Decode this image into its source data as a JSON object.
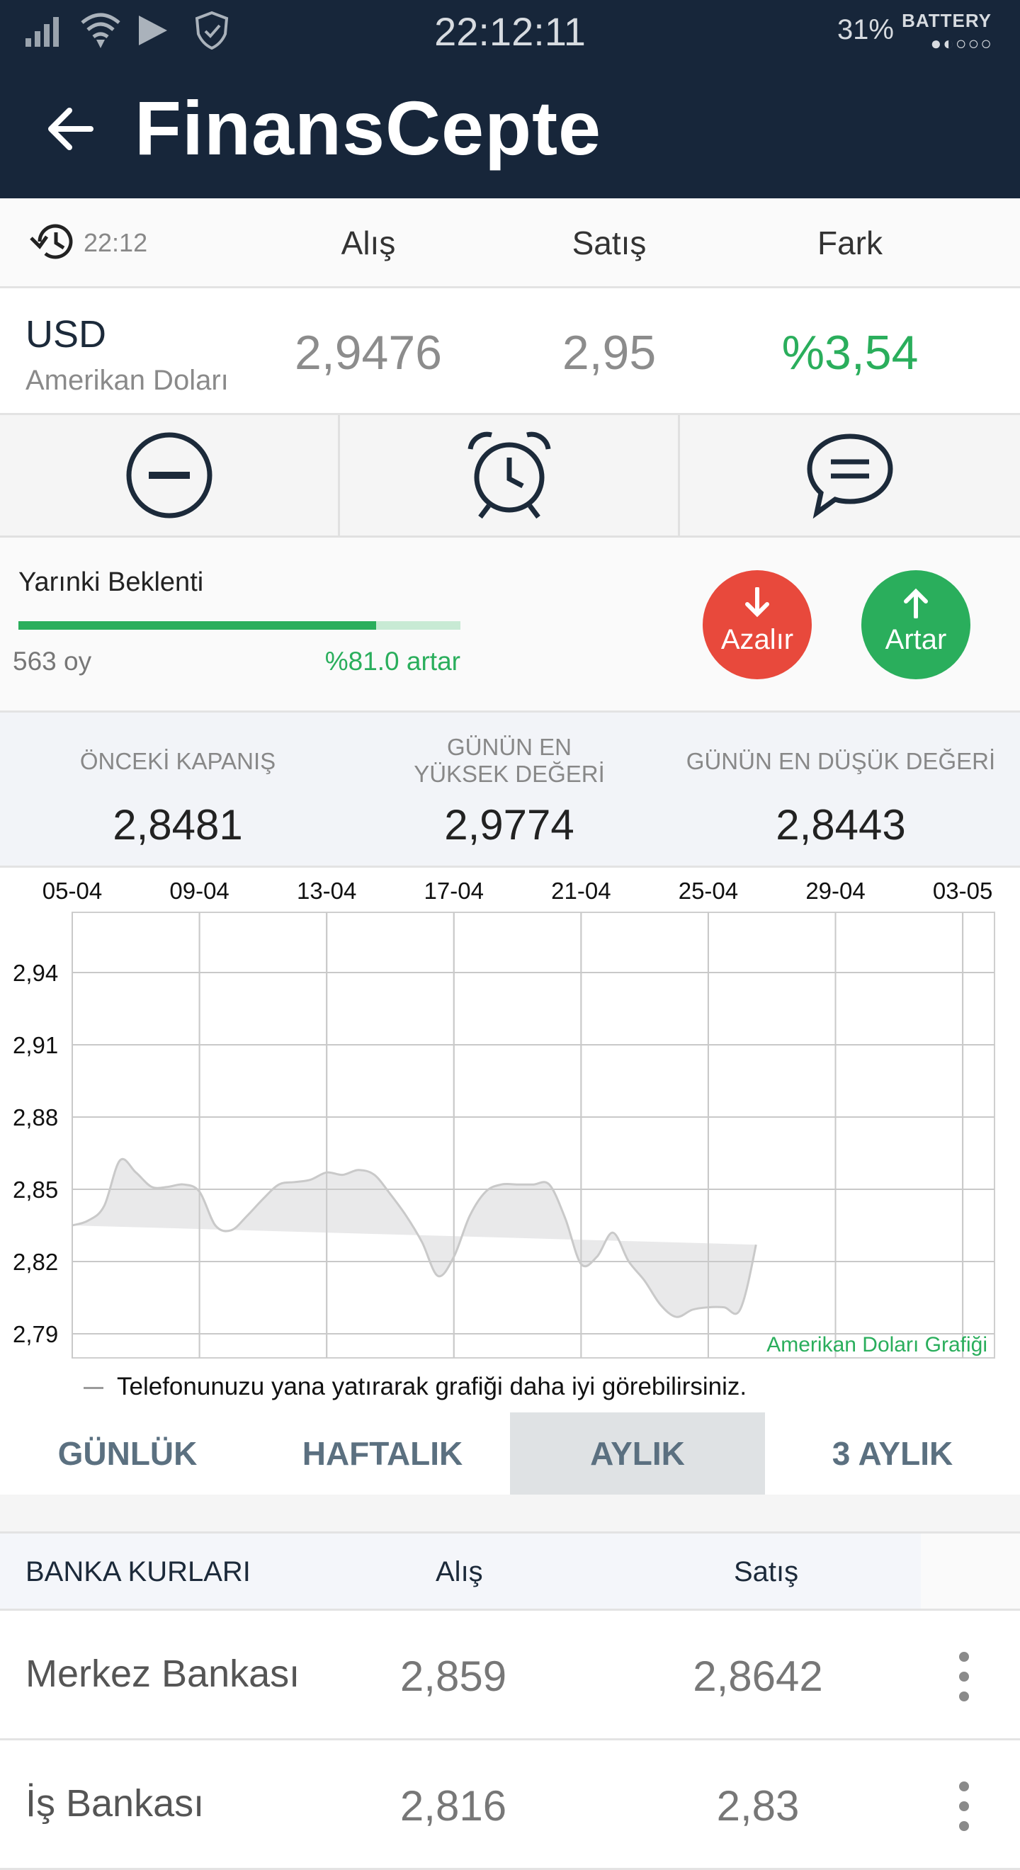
{
  "status_bar": {
    "time": "22:12:11",
    "battery_percent": "31%",
    "battery_label": "BATTERY",
    "icons": [
      "signal-icon",
      "wifi-icon",
      "play-icon",
      "shield-icon"
    ]
  },
  "app_bar": {
    "title": "FinansCepte",
    "back_icon": "back-arrow-icon"
  },
  "rate_header": {
    "time": "22:12",
    "col_buy": "Alış",
    "col_sell": "Satış",
    "col_diff": "Fark"
  },
  "currency": {
    "code": "USD",
    "name": "Amerikan Doları",
    "buy": "2,9476",
    "sell": "2,95",
    "diff": "%3,54",
    "diff_color": "#2aae5c"
  },
  "actions": [
    "remove-icon",
    "alarm-icon",
    "comment-icon"
  ],
  "expectation": {
    "label": "Yarınki Beklenti",
    "votes": "563 oy",
    "percent_text": "%81.0 artar",
    "increase_fraction": 0.81,
    "decrease_label": "Azalır",
    "increase_label": "Artar",
    "decrease_color": "#e8493c",
    "increase_color": "#2aae5c"
  },
  "stats": [
    {
      "label": "ÖNCEKİ KAPANIŞ",
      "value": "2,8481"
    },
    {
      "label": "GÜNÜN EN YÜKSEK DEĞERİ",
      "value": "2,9774"
    },
    {
      "label": "GÜNÜN EN DÜŞÜK DEĞERİ",
      "value": "2,8443"
    }
  ],
  "chart_data": {
    "type": "area",
    "title": "",
    "watermark": "Amerikan Doları Grafiği",
    "x_ticks": [
      "05-04",
      "09-04",
      "13-04",
      "17-04",
      "21-04",
      "25-04",
      "29-04",
      "03-05"
    ],
    "y_ticks": [
      "2,94",
      "2,91",
      "2,88",
      "2,85",
      "2,82",
      "2,79"
    ],
    "y_tick_values": [
      2.94,
      2.91,
      2.88,
      2.85,
      2.82,
      2.79
    ],
    "ylim": [
      2.78,
      2.965
    ],
    "x_day_range": [
      0,
      29
    ],
    "grid": true,
    "fill_color": "#e9e9ea",
    "line_color": "#c9c9c9",
    "x": [
      0,
      0.5,
      1,
      1.5,
      2,
      2.5,
      3,
      3.5,
      4,
      4.5,
      5,
      5.5,
      6,
      6.5,
      7,
      7.5,
      8,
      8.5,
      9,
      9.5,
      10,
      10.5,
      11,
      11.5,
      12,
      12.5,
      13,
      13.5,
      14,
      14.5,
      15,
      15.5,
      16,
      16.5,
      17,
      17.5,
      18,
      18.5,
      19,
      19.5,
      20,
      20.5,
      21,
      21.5,
      22,
      22.5,
      23,
      23.5,
      24,
      24.5,
      25,
      25.5,
      26,
      26.5,
      27,
      27.5,
      28,
      28.5,
      29
    ],
    "values": [
      2.835,
      2.837,
      2.843,
      2.862,
      2.857,
      2.851,
      2.851,
      2.852,
      2.849,
      2.835,
      2.833,
      2.839,
      2.846,
      2.852,
      2.853,
      2.854,
      2.857,
      2.856,
      2.858,
      2.856,
      2.848,
      2.839,
      2.828,
      2.814,
      2.822,
      2.839,
      2.849,
      2.852,
      2.852,
      2.852,
      2.852,
      2.838,
      2.819,
      2.822,
      2.832,
      2.82,
      2.812,
      2.802,
      2.797,
      2.8,
      2.801,
      2.801,
      2.8,
      2.827,
      2.867
    ]
  },
  "chart_hint": "Telefonunuzu yana yatırarak grafiği daha iyi görebilirsiniz.",
  "tabs": [
    {
      "label": "GÜNLÜK",
      "active": false
    },
    {
      "label": "HAFTALIK",
      "active": false
    },
    {
      "label": "AYLIK",
      "active": true
    },
    {
      "label": "3 AYLIK",
      "active": false
    }
  ],
  "bank_table": {
    "header": {
      "title": "BANKA KURLARI",
      "buy": "Alış",
      "sell": "Satış"
    },
    "rows": [
      {
        "name": "Merkez Bankası",
        "buy": "2,859",
        "sell": "2,8642"
      },
      {
        "name": "İş Bankası",
        "buy": "2,816",
        "sell": "2,83"
      }
    ]
  }
}
